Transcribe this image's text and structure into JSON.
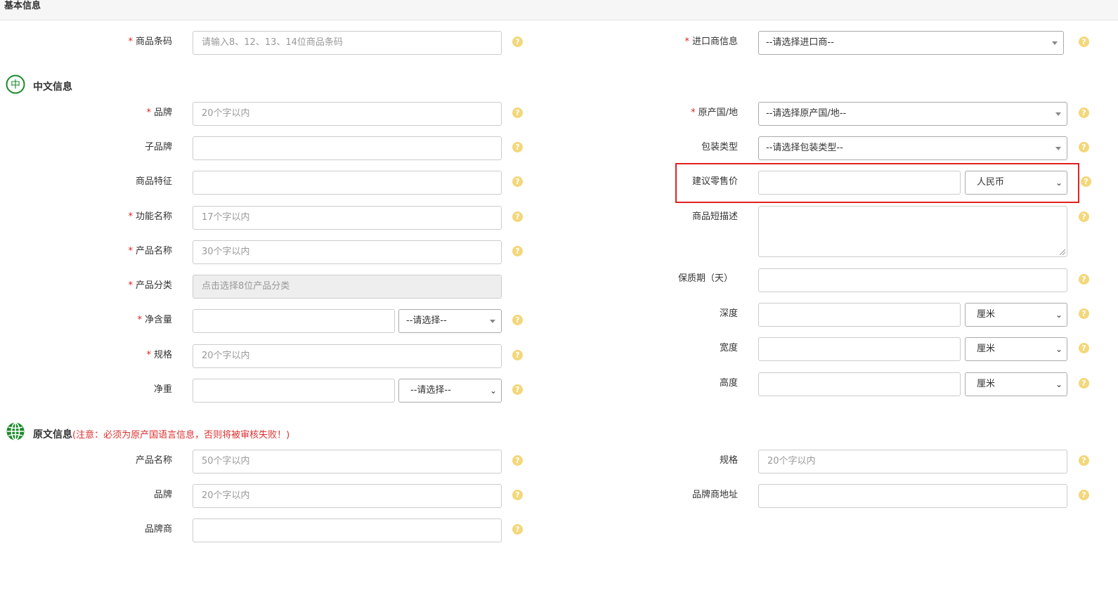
{
  "header": {
    "title": "基本信息"
  },
  "sections": {
    "chinese": {
      "title": "中文信息",
      "icon": "zhong-badge-icon",
      "icon_text": "中"
    },
    "original": {
      "title": "原文信息",
      "note": "(注意：必须为原产国语言信息，否则将被审核失败！)",
      "icon": "globe-icon"
    }
  },
  "fields": {
    "barcode": {
      "label": "商品条码",
      "placeholder": "请输入8、12、13、14位商品条码"
    },
    "importer": {
      "label": "进口商信息",
      "value": "--请选择进口商--"
    },
    "brand": {
      "label": "品牌",
      "placeholder": "20个字以内"
    },
    "origin_country": {
      "label": "原产国/地",
      "value": "--请选择原产国/地--"
    },
    "sub_brand": {
      "label": "子品牌"
    },
    "package_type": {
      "label": "包装类型",
      "value": "--请选择包装类型--"
    },
    "feature": {
      "label": "商品特征"
    },
    "retail_price": {
      "label": "建议零售价",
      "currency": "人民币"
    },
    "function_name": {
      "label": "功能名称",
      "placeholder": "17个字以内"
    },
    "short_desc": {
      "label": "商品短描述"
    },
    "product_name": {
      "label": "产品名称",
      "placeholder": "30个字以内"
    },
    "shelf_life": {
      "label": "保质期（天）"
    },
    "category": {
      "label": "产品分类",
      "placeholder": "点击选择8位产品分类"
    },
    "depth": {
      "label": "深度",
      "unit": "厘米"
    },
    "net_content": {
      "label": "净含量",
      "unit": "--请选择--"
    },
    "width": {
      "label": "宽度",
      "unit": "厘米"
    },
    "spec": {
      "label": "规格",
      "placeholder": "20个字以内"
    },
    "height": {
      "label": "高度",
      "unit": "厘米"
    },
    "net_weight": {
      "label": "净重",
      "unit": "--请选择--"
    },
    "orig_product_name": {
      "label": "产品名称",
      "placeholder": "50个字以内"
    },
    "orig_spec": {
      "label": "规格",
      "placeholder": "20个字以内"
    },
    "orig_brand": {
      "label": "品牌",
      "placeholder": "20个字以内"
    },
    "orig_brand_address": {
      "label": "品牌商地址"
    },
    "orig_brand_owner": {
      "label": "品牌商"
    }
  },
  "required_mark": "*",
  "help_icon": "question-circle-icon",
  "help_glyph": "?",
  "colors": {
    "required": "#e02020",
    "help": "#f3d77a",
    "accent_green": "#1a8a2a",
    "highlight": "#e02020"
  }
}
